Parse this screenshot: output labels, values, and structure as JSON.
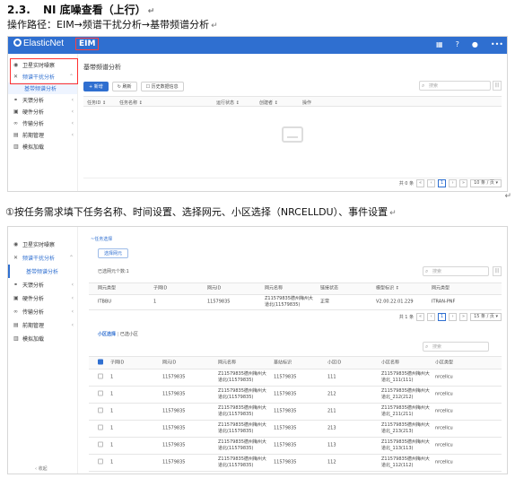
{
  "doc": {
    "heading_number": "2.3.",
    "heading_text": "NI 底噪查看（上行）",
    "operation_path": "操作路径：EIM→频谱干扰分析→基带频谱分析",
    "step_text": "①按任务需求填下任务名称、时间设置、选择网元、小区选择（NRCELLDU）、事件设置",
    "return_mark": "↵",
    "crlf_mark": "↵"
  },
  "app": {
    "brand": "ElasticNet",
    "module": "EIM",
    "icons": [
      "grid-icon",
      "help-icon",
      "user-icon",
      "more-icon"
    ]
  },
  "sidebar": {
    "items": [
      {
        "label": "卫星实时噪察",
        "icon": "satellite-icon",
        "arrow": ""
      },
      {
        "label": "频谱干扰分析",
        "icon": "spectrum-icon",
        "arrow": "⌃"
      },
      {
        "label": "天馈分析",
        "icon": "antenna-icon",
        "arrow": "‹"
      },
      {
        "label": "硬件分析",
        "icon": "hardware-icon",
        "arrow": "‹"
      },
      {
        "label": "传输分析",
        "icon": "link-icon",
        "arrow": "‹"
      },
      {
        "label": "前期管理",
        "icon": "manage-icon",
        "arrow": "‹"
      },
      {
        "label": "模拟加载",
        "icon": "load-icon",
        "arrow": ""
      }
    ],
    "sub_item": "基带频谱分析",
    "collapse_label": "‹ 收起"
  },
  "screen1": {
    "page_title": "基带频谱分析",
    "buttons": [
      "+ 新增",
      "↻ 刷新",
      "☐ 历史数据信息"
    ],
    "search_placeholder": "搜索",
    "columns": [
      "任务ID ↕",
      "任务名称 ↕",
      "运行状态 ↕",
      "创建者 ↕",
      "操作"
    ],
    "pager_total": "共 0 条",
    "pager_page": "1",
    "pager_size": "10 条 / 页 ▾",
    "pager_nav": [
      "«",
      "‹",
      "›",
      "»"
    ]
  },
  "screen2": {
    "crumb": "~任务选择",
    "select_ne_btn": "选择网元",
    "selected_ne": "已选网元个数:1",
    "search_placeholder": "搜索",
    "ne_columns": [
      "网元类型",
      "子网ID",
      "网元ID",
      "网元名称",
      "链接状态",
      "模型标识 ↕",
      "网元类型"
    ],
    "ne_rows": [
      [
        "ITBBU",
        "1",
        "11579835",
        "Z11579835德州梅州大道北(11579835)",
        "正常",
        "V2.00.22.01.229",
        "ITRAN-PNF"
      ]
    ],
    "pager_total": "共 1 条",
    "pager_page": "1",
    "pager_size": "15 条 / 页 ▾",
    "pager_nav": [
      "«",
      "‹",
      "›",
      "»"
    ],
    "cell_tab_active": "小区选择",
    "cell_tab_other": "已选小区",
    "cell_search_placeholder": "搜索",
    "cell_columns": [
      "子网ID",
      "网元ID",
      "网元名称",
      "基站标识",
      "小区ID",
      "小区名称",
      "小区类型"
    ],
    "cell_rows": [
      [
        "1",
        "11579835",
        "Z11579835德州梅州大道北(11579835)",
        "11579835",
        "111",
        "Z11579835德州梅州大道北_111(111)",
        "nrcellcu"
      ],
      [
        "1",
        "11579835",
        "Z11579835德州梅州大道北(11579835)",
        "11579835",
        "212",
        "Z11579835德州梅州大道北_212(212)",
        "nrcellcu"
      ],
      [
        "1",
        "11579835",
        "Z11579835德州梅州大道北(11579835)",
        "11579835",
        "211",
        "Z11579835德州梅州大道北_211(211)",
        "nrcellcu"
      ],
      [
        "1",
        "11579835",
        "Z11579835德州梅州大道北(11579835)",
        "11579835",
        "213",
        "Z11579835德州梅州大道北_213(213)",
        "nrcellcu"
      ],
      [
        "1",
        "11579835",
        "Z11579835德州梅州大道北(11579835)",
        "11579835",
        "113",
        "Z11579835德州梅州大道北_113(113)",
        "nrcellcu"
      ],
      [
        "1",
        "11579835",
        "Z11579835德州梅州大道北(11579835)",
        "11579835",
        "112",
        "Z11579835德州梅州大道北_112(112)",
        "nrcellcu"
      ]
    ]
  }
}
